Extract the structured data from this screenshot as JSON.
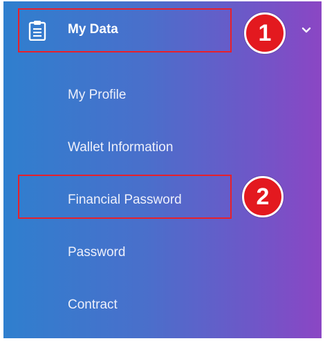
{
  "menu": {
    "header_label": "My Data",
    "header_icon": "clipboard-icon",
    "expand_icon": "chevron-down-icon",
    "items": [
      {
        "label": "My Profile"
      },
      {
        "label": "Wallet Information"
      },
      {
        "label": "Financial Password"
      },
      {
        "label": "Password"
      },
      {
        "label": "Contract"
      }
    ]
  },
  "annotations": {
    "step_1": "1",
    "step_2": "2",
    "highlight_color": "#e8202a",
    "badge_color": "#e3191f"
  },
  "colors": {
    "gradient_start": "#2f7fce",
    "gradient_end": "#8b46c4",
    "text": "#ffffff"
  }
}
